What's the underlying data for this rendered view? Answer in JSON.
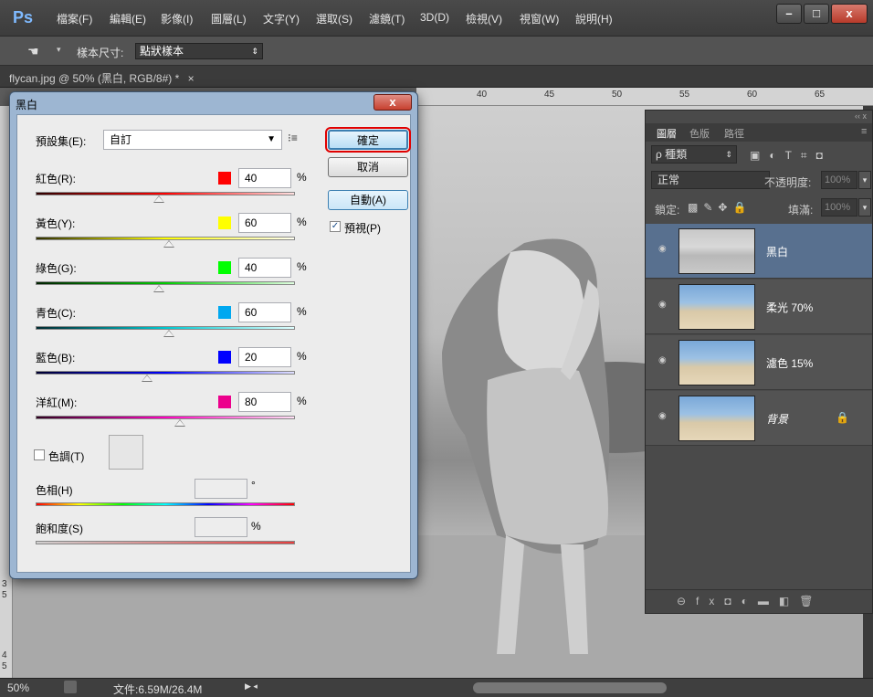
{
  "app": {
    "logo": "Ps"
  },
  "menu": [
    "檔案(F)",
    "編輯(E)",
    "影像(I)",
    "圖層(L)",
    "文字(Y)",
    "選取(S)",
    "濾鏡(T)",
    "3D(D)",
    "檢視(V)",
    "視窗(W)",
    "說明(H)"
  ],
  "window_controls": {
    "minimize": "–",
    "maximize": "□",
    "close": "x"
  },
  "options_bar": {
    "tool_icon": "eyedropper-hand-icon",
    "sample_size_label": "樣本尺寸:",
    "sample_size_value": "點狀樣本"
  },
  "doc_tab": {
    "label": "flycan.jpg @ 50% (黑白, RGB/8#) *",
    "close": "×"
  },
  "ruler": {
    "top_numbers": [
      "40",
      "45",
      "50",
      "55",
      "60",
      "65"
    ],
    "left_numbers": [
      "3",
      "5",
      "4",
      "5"
    ]
  },
  "dialog": {
    "title": "黑白",
    "close": "x",
    "preset_label": "預設集(E):",
    "preset_value": "自訂",
    "ok": "確定",
    "cancel": "取消",
    "auto": "自動(A)",
    "preview_label": "預視(P)",
    "preview_checked": true,
    "sliders": [
      {
        "label": "紅色(R):",
        "value": "40",
        "pct": "%",
        "color": "#ff0000"
      },
      {
        "label": "黃色(Y):",
        "value": "60",
        "pct": "%",
        "color": "#ffff00"
      },
      {
        "label": "綠色(G):",
        "value": "40",
        "pct": "%",
        "color": "#00ff00"
      },
      {
        "label": "青色(C):",
        "value": "60",
        "pct": "%",
        "color": "#00a8f0"
      },
      {
        "label": "藍色(B):",
        "value": "20",
        "pct": "%",
        "color": "#0000ff"
      },
      {
        "label": "洋紅(M):",
        "value": "80",
        "pct": "%",
        "color": "#ec008c"
      }
    ],
    "tint_label": "色調(T)",
    "hue_label": "色相(H)",
    "hue_unit": "°",
    "saturation_label": "飽和度(S)",
    "saturation_unit": "%"
  },
  "layers_panel": {
    "tabs": [
      "圖層",
      "色版",
      "路徑"
    ],
    "filter_kind": "ρ 種類",
    "blend_mode": "正常",
    "opacity_label": "不透明度:",
    "opacity_value": "100%",
    "lock_label": "鎖定:",
    "fill_label": "填滿:",
    "fill_value": "100%",
    "layers": [
      {
        "name": "黑白",
        "selected": true
      },
      {
        "name": "柔光 70%",
        "selected": false
      },
      {
        "name": "濾色 15%",
        "selected": false
      },
      {
        "name": "背景",
        "selected": false,
        "locked": true
      }
    ]
  },
  "status": {
    "zoom": "50%",
    "file_info": "文件:6.59M/26.4M"
  }
}
